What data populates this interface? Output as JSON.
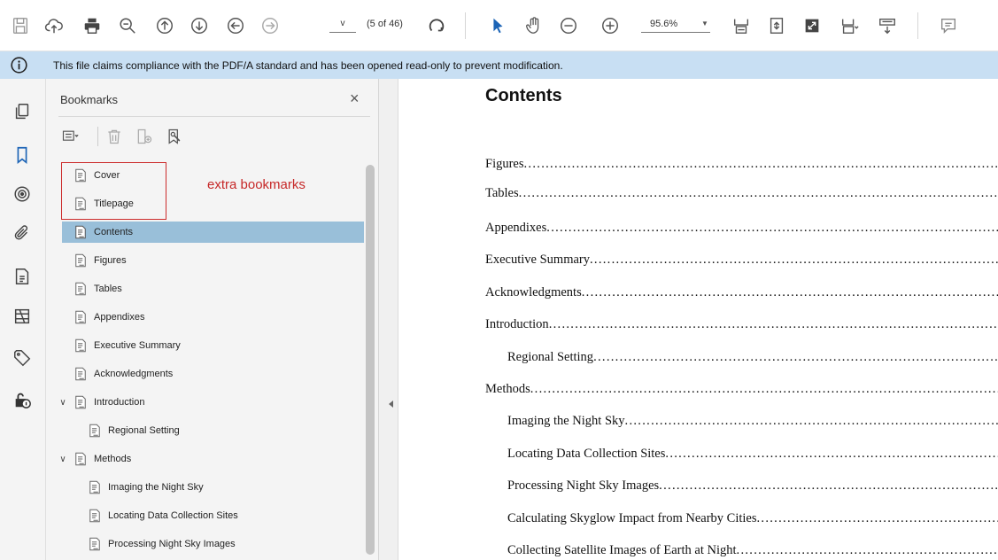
{
  "toolbar": {
    "page_value": "v",
    "page_count": "(5 of 46)",
    "zoom_value": "95.6%",
    "buttons": [
      {
        "icon": "save-icon"
      },
      {
        "icon": "upload-cloud-icon"
      },
      {
        "icon": "print-icon"
      },
      {
        "icon": "zoom-search-icon"
      },
      {
        "icon": "prev-page-icon"
      },
      {
        "icon": "next-page-icon"
      },
      {
        "icon": "back-icon"
      },
      {
        "icon": "forward-icon"
      },
      {
        "icon": "rotate-icon"
      },
      {
        "icon": "select-cursor-icon"
      },
      {
        "icon": "hand-tool-icon"
      },
      {
        "icon": "zoom-out-icon"
      },
      {
        "icon": "zoom-in-icon"
      },
      {
        "icon": "fit-width-icon"
      },
      {
        "icon": "fit-page-icon"
      },
      {
        "icon": "full-screen-icon"
      },
      {
        "icon": "page-display-icon"
      },
      {
        "icon": "scroll-mode-icon"
      },
      {
        "icon": "comment-icon"
      }
    ]
  },
  "infobar": {
    "message": "This file claims compliance with the PDF/A standard and has been opened read-only to prevent modification."
  },
  "rail": {
    "items": [
      "pages-icon",
      "bookmarks-icon",
      "layers-icon",
      "attachments-icon",
      "document-properties-icon",
      "tags-structure-icon",
      "tags-icon",
      "security-icon"
    ]
  },
  "bookmarks_panel": {
    "title": "Bookmarks",
    "close": "×",
    "annotation": "extra bookmarks",
    "items": [
      {
        "label": "Cover"
      },
      {
        "label": "Titlepage"
      },
      {
        "label": "Contents",
        "selected": true
      },
      {
        "label": "Figures"
      },
      {
        "label": "Tables"
      },
      {
        "label": "Appendixes"
      },
      {
        "label": "Executive Summary"
      },
      {
        "label": "Acknowledgments"
      },
      {
        "label": "Introduction",
        "expanded": true
      },
      {
        "label": "Regional Setting"
      },
      {
        "label": "Methods",
        "expanded": true
      },
      {
        "label": "Imaging the Night Sky"
      },
      {
        "label": "Locating Data Collection Sites"
      },
      {
        "label": "Processing Night Sky Images"
      }
    ]
  },
  "document": {
    "title": "Contents",
    "toc": [
      {
        "label": "Figures"
      },
      {
        "label": "Tables"
      },
      {
        "label": "Appendixes "
      },
      {
        "label": "Executive Summary "
      },
      {
        "label": "Acknowledgments "
      },
      {
        "label": "Introduction"
      },
      {
        "label": "Regional Setting "
      },
      {
        "label": "Methods "
      },
      {
        "label": "Imaging the Night Sky"
      },
      {
        "label": "Locating Data Collection Sites "
      },
      {
        "label": "Processing Night Sky Images"
      },
      {
        "label": "Calculating Skyglow Impact from Nearby Cities "
      },
      {
        "label": "Collecting Satellite Images of Earth at Night"
      }
    ]
  }
}
